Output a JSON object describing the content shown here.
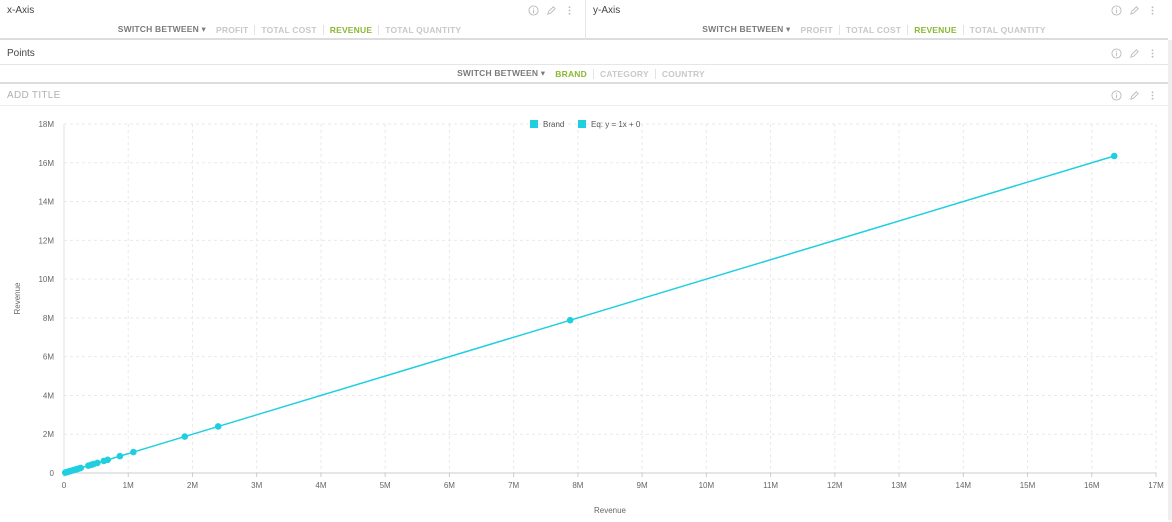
{
  "xaxis_panel": {
    "title": "x-Axis",
    "switch_label": "SWITCH BETWEEN",
    "options": [
      "PROFIT",
      "TOTAL COST",
      "REVENUE",
      "TOTAL QUANTITY"
    ],
    "active": "REVENUE"
  },
  "yaxis_panel": {
    "title": "y-Axis",
    "switch_label": "SWITCH BETWEEN",
    "options": [
      "PROFIT",
      "TOTAL COST",
      "REVENUE",
      "TOTAL QUANTITY"
    ],
    "active": "REVENUE"
  },
  "points_panel": {
    "title": "Points",
    "switch_label": "SWITCH BETWEEN",
    "options": [
      "BRAND",
      "CATEGORY",
      "COUNTRY"
    ],
    "active": "BRAND"
  },
  "chart_panel": {
    "title": "ADD TITLE"
  },
  "colors": {
    "accent_active": "#8ab833",
    "series": "#1fcfe0",
    "grid": "#e9e9e9"
  },
  "chart_data": {
    "type": "scatter",
    "title": "",
    "xlabel": "Revenue",
    "ylabel": "Revenue",
    "xlim": [
      0,
      17000000
    ],
    "ylim": [
      0,
      18000000
    ],
    "x_ticks": [
      0,
      1000000,
      2000000,
      3000000,
      4000000,
      5000000,
      6000000,
      7000000,
      8000000,
      9000000,
      10000000,
      11000000,
      12000000,
      13000000,
      14000000,
      15000000,
      16000000,
      17000000
    ],
    "x_tick_labels": [
      "0",
      "1M",
      "2M",
      "3M",
      "4M",
      "5M",
      "6M",
      "7M",
      "8M",
      "9M",
      "10M",
      "11M",
      "12M",
      "13M",
      "14M",
      "15M",
      "16M",
      "17M"
    ],
    "y_ticks": [
      0,
      2000000,
      4000000,
      6000000,
      8000000,
      10000000,
      12000000,
      14000000,
      16000000,
      18000000
    ],
    "y_tick_labels": [
      "0",
      "2M",
      "4M",
      "6M",
      "8M",
      "10M",
      "12M",
      "14M",
      "16M",
      "18M"
    ],
    "grid": true,
    "legend_position": "top-center",
    "series": [
      {
        "name": "Brand",
        "color": "#1fcfe0",
        "points": [
          [
            20000,
            20000
          ],
          [
            40000,
            40000
          ],
          [
            60000,
            60000
          ],
          [
            80000,
            80000
          ],
          [
            100000,
            100000
          ],
          [
            120000,
            120000
          ],
          [
            150000,
            150000
          ],
          [
            180000,
            180000
          ],
          [
            200000,
            200000
          ],
          [
            230000,
            230000
          ],
          [
            260000,
            260000
          ],
          [
            380000,
            380000
          ],
          [
            420000,
            420000
          ],
          [
            460000,
            460000
          ],
          [
            520000,
            520000
          ],
          [
            620000,
            620000
          ],
          [
            680000,
            680000
          ],
          [
            870000,
            870000
          ],
          [
            1080000,
            1080000
          ],
          [
            1880000,
            1880000
          ],
          [
            2400000,
            2400000
          ],
          [
            7880000,
            7880000
          ],
          [
            16350000,
            16350000
          ]
        ]
      },
      {
        "name": "Eq: y = 1x + 0",
        "color": "#1fcfe0",
        "type": "line",
        "slope": 1,
        "intercept": 0
      }
    ]
  }
}
